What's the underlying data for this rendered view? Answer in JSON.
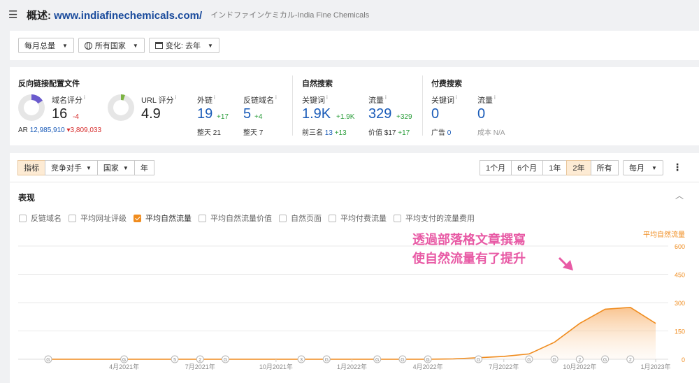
{
  "header": {
    "title_prefix": "概述: ",
    "domain": "www.indiafinechemicals.com/",
    "subtitle": "インドファインケミカル-India Fine Chemicals"
  },
  "filters": {
    "volume": "每月总量",
    "country": "所有国家",
    "change": "变化: 去年"
  },
  "backlinks": {
    "title": "反向链接配置文件",
    "dr_label": "域名评分",
    "dr_value": "16",
    "dr_delta": "-4",
    "dr_fraction": 0.16,
    "ur_label": "URL 评分",
    "ur_value": "4.9",
    "ur_fraction": 0.05,
    "ar_label": "AR",
    "ar_value": "12,985,910",
    "ar_delta": "▾3,809,033",
    "ext_label": "外链",
    "ext_value": "19",
    "ext_delta": "+17",
    "ext_sub_label": "整天",
    "ext_sub_value": "21",
    "rd_label": "反链域名",
    "rd_value": "5",
    "rd_delta": "+4",
    "rd_sub_label": "整天",
    "rd_sub_value": "7"
  },
  "organic": {
    "title": "自然搜索",
    "kw_label": "关键词",
    "kw_value": "1.9K",
    "kw_delta": "+1.9K",
    "kw_sub_label": "前三名",
    "kw_sub_value": "13",
    "kw_sub_delta": "+13",
    "traffic_label": "流量",
    "traffic_value": "329",
    "traffic_delta": "+329",
    "traffic_sub_label": "价值",
    "traffic_sub_value": "$17",
    "traffic_sub_delta": "+17"
  },
  "paid": {
    "title": "付费搜索",
    "kw_label": "关键词",
    "kw_value": "0",
    "kw_sub_label": "广告",
    "kw_sub_value": "0",
    "traffic_label": "流量",
    "traffic_value": "0",
    "traffic_sub_label": "成本",
    "traffic_sub_value": "N/A"
  },
  "chart_panel": {
    "tabs": [
      "指标",
      "竞争对手",
      "国家",
      "年"
    ],
    "ranges": [
      "1个月",
      "6个月",
      "1年",
      "2年",
      "所有"
    ],
    "active_range": "2年",
    "period": "每月",
    "section_title": "表现",
    "legend": [
      {
        "label": "反链域名",
        "checked": false
      },
      {
        "label": "平均网址评级",
        "checked": false
      },
      {
        "label": "平均自然流量",
        "checked": true
      },
      {
        "label": "平均自然流量价值",
        "checked": false
      },
      {
        "label": "自然页面",
        "checked": false
      },
      {
        "label": "平均付费流量",
        "checked": false
      },
      {
        "label": "平均支付的流量费用",
        "checked": false
      }
    ]
  },
  "annotation": {
    "line1": "透過部落格文章撰寫",
    "line2": "使自然流量有了提升"
  },
  "colors": {
    "accent": "#f08c1e",
    "annotation": "#e85aa5",
    "link_blue": "#1a5bb8"
  },
  "chart_data": {
    "type": "area",
    "series": [
      {
        "name": "平均自然流量",
        "x": [
          "2021-01",
          "2021-02",
          "2021-03",
          "2021-04",
          "2021-05",
          "2021-06",
          "2021-07",
          "2021-08",
          "2021-09",
          "2021-10",
          "2021-11",
          "2021-12",
          "2022-01",
          "2022-02",
          "2022-03",
          "2022-04",
          "2022-05",
          "2022-06",
          "2022-07",
          "2022-08",
          "2022-09",
          "2022-10",
          "2022-11",
          "2022-12",
          "2023-01"
        ],
        "values": [
          0,
          0,
          0,
          0,
          0,
          0,
          0,
          0,
          0,
          0,
          0,
          0,
          0,
          0,
          0,
          0,
          2,
          8,
          15,
          28,
          90,
          190,
          265,
          275,
          190
        ]
      }
    ],
    "x_ticks": [
      "4月2021年",
      "7月2021年",
      "10月2021年",
      "1月2022年",
      "4月2022年",
      "7月2022年",
      "10月2022年",
      "1月2023年"
    ],
    "x_tick_months": [
      "2021-04",
      "2021-07",
      "2021-10",
      "2022-01",
      "2022-04",
      "2022-07",
      "2022-10",
      "2023-01"
    ],
    "y_ticks": [
      0,
      150,
      300,
      450,
      600
    ],
    "ylim": [
      0,
      600
    ],
    "y_axis_title": "平均自然流量",
    "y_axis_side": "right",
    "grid": true,
    "event_markers": [
      {
        "month": "2021-01",
        "label": "G"
      },
      {
        "month": "2021-04",
        "label": "G"
      },
      {
        "month": "2021-06",
        "label": "5"
      },
      {
        "month": "2021-07",
        "label": "2"
      },
      {
        "month": "2021-08",
        "label": "G"
      },
      {
        "month": "2021-11",
        "label": "3"
      },
      {
        "month": "2021-12",
        "label": "G"
      },
      {
        "month": "2022-02",
        "label": "G"
      },
      {
        "month": "2022-03",
        "label": "G"
      },
      {
        "month": "2022-04",
        "label": "G"
      },
      {
        "month": "2022-06",
        "label": "G"
      },
      {
        "month": "2022-08",
        "label": "G"
      },
      {
        "month": "2022-09",
        "label": "G"
      },
      {
        "month": "2022-10",
        "label": "2"
      },
      {
        "month": "2022-11",
        "label": "G"
      },
      {
        "month": "2022-12",
        "label": "2"
      }
    ]
  }
}
